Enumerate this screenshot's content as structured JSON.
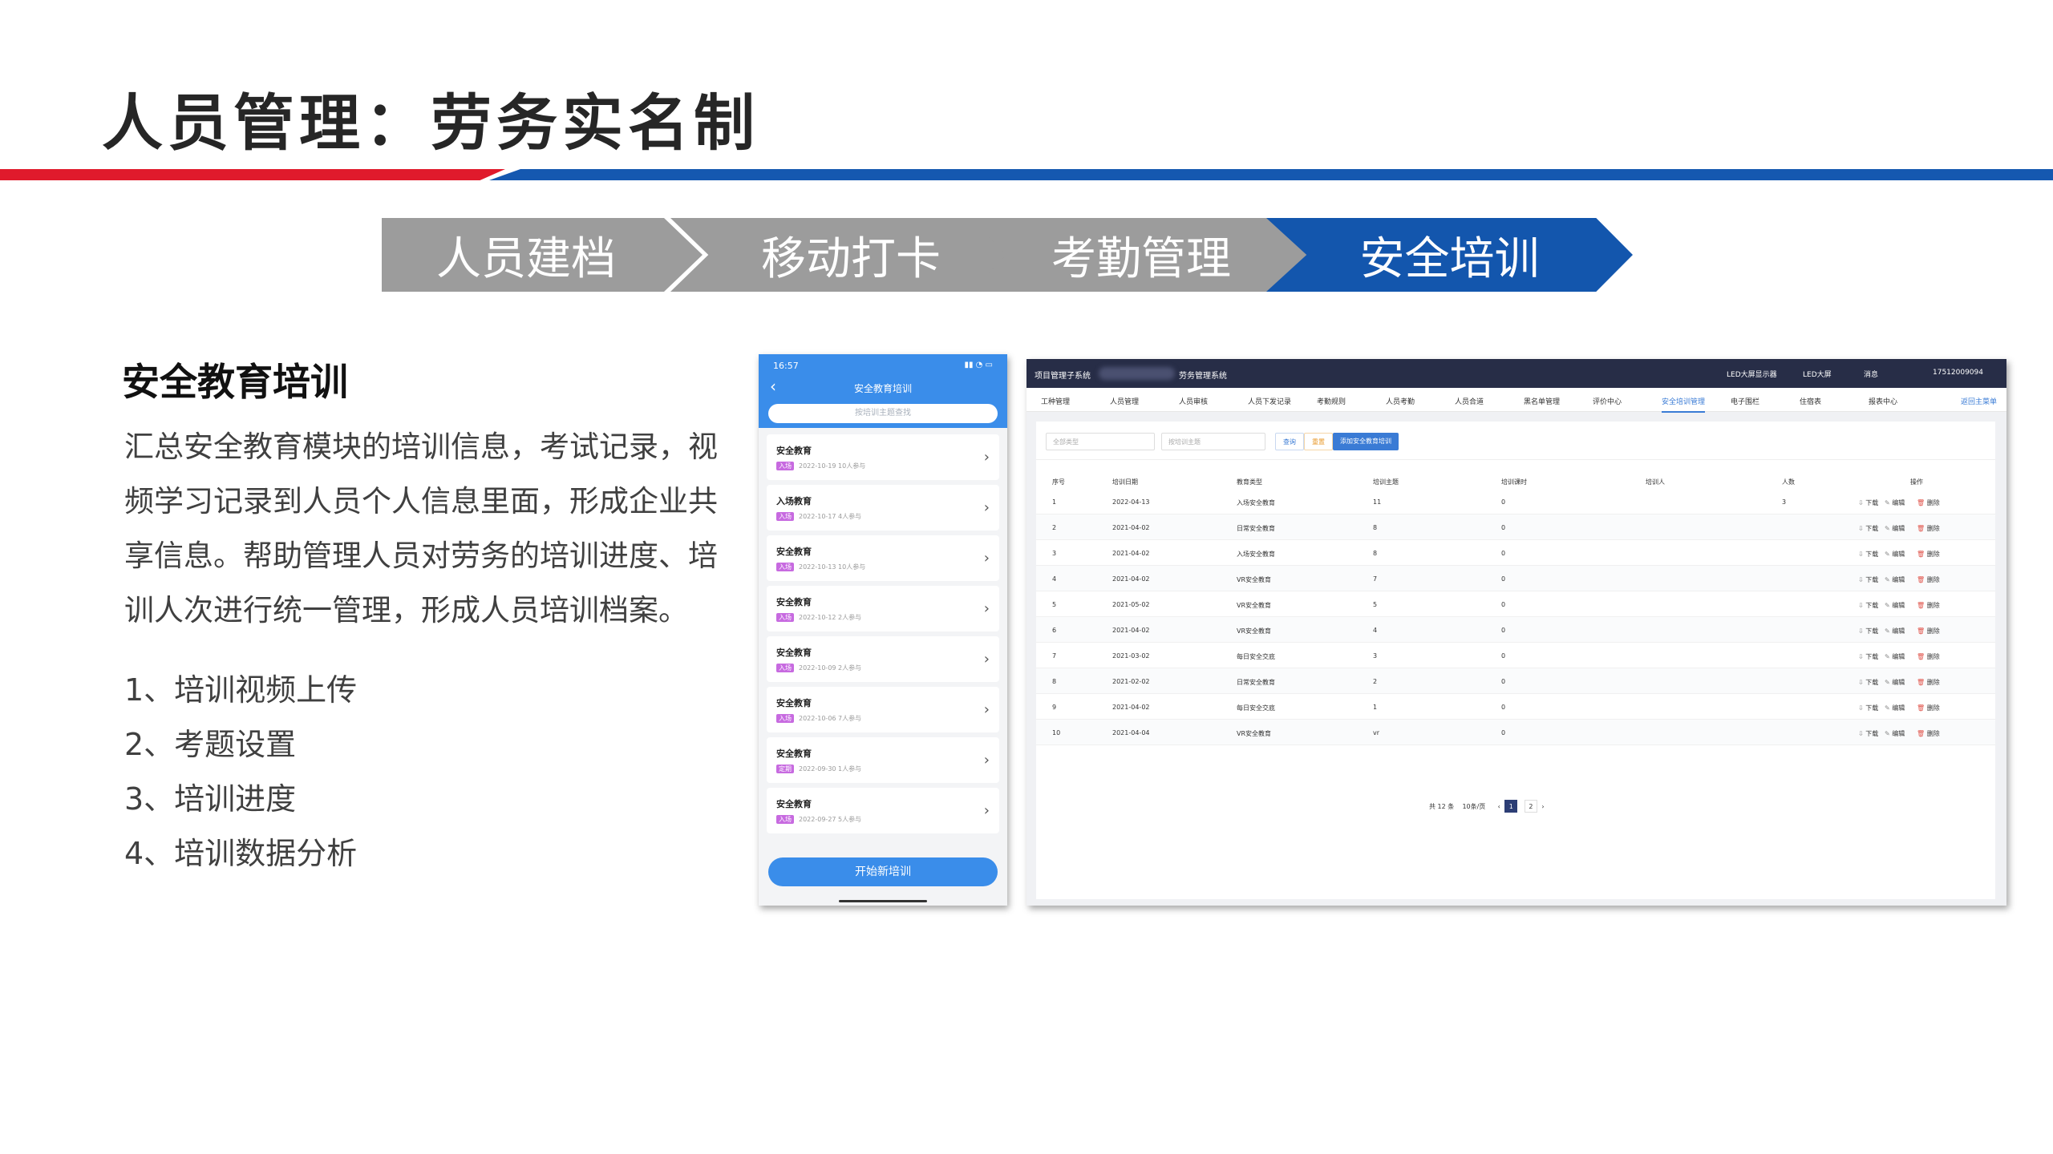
{
  "slide": {
    "title": "人员管理：劳务实名制",
    "steps": [
      "人员建档",
      "移动打卡",
      "考勤管理",
      "安全培训"
    ],
    "section_title": "安全教育培训",
    "description": "汇总安全教育模块的培训信息，考试记录，视频学习记录到人员个人信息里面，形成企业共享信息。帮助管理人员对劳务的培训进度、培训人次进行统一管理，形成人员培训档案。",
    "features": [
      "1、培训视频上传",
      "2、考题设置",
      "3、培训进度",
      "4、培训数据分析"
    ]
  },
  "phone": {
    "status_time": "16:57",
    "back": "‹",
    "title": "安全教育培训",
    "search_placeholder": "按培训主题查找",
    "items": [
      {
        "title": "安全教育",
        "tag": "入场",
        "meta": "2022-10-19  10人参与"
      },
      {
        "title": "入场教育",
        "tag": "入场",
        "meta": "2022-10-17  4人参与"
      },
      {
        "title": "安全教育",
        "tag": "入场",
        "meta": "2022-10-13  10人参与"
      },
      {
        "title": "安全教育",
        "tag": "入场",
        "meta": "2022-10-12  2人参与"
      },
      {
        "title": "安全教育",
        "tag": "入场",
        "meta": "2022-10-09  2人参与"
      },
      {
        "title": "安全教育",
        "tag": "入场",
        "meta": "2022-10-06  7人参与"
      },
      {
        "title": "安全教育",
        "tag": "定期",
        "meta": "2022-09-30  1人参与"
      },
      {
        "title": "安全教育",
        "tag": "入场",
        "meta": "2022-09-27  5人参与"
      }
    ],
    "start_button": "开始新培训"
  },
  "desktop": {
    "system_name": "项目管理子系统",
    "module_name": "劳务管理系统",
    "top_right": [
      "LED大屏显示器",
      "LED大屏",
      "消息",
      "17512009094"
    ],
    "nav": [
      "工种管理",
      "人员管理",
      "人员审核",
      "人员下发记录",
      "考勤规则",
      "人员考勤",
      "人员合道",
      "黑名单管理",
      "评价中心",
      "安全培训管理",
      "电子围栏",
      "住宿表",
      "报表中心",
      "返回主菜单"
    ],
    "filter": {
      "select_placeholder": "全部类型",
      "search_placeholder": "按培训主题",
      "search_btn": "查询",
      "reset_btn": "重置",
      "add_btn": "添加安全教育培训"
    },
    "columns": [
      "序号",
      "培训日期",
      "教育类型",
      "培训主题",
      "培训课时",
      "培训人",
      "人数",
      "操作"
    ],
    "rows": [
      [
        "1",
        "2022-04-13",
        "入场安全教育",
        "11",
        "0",
        "",
        "3"
      ],
      [
        "2",
        "2021-04-02",
        "日常安全教育",
        "8",
        "0",
        "",
        ""
      ],
      [
        "3",
        "2021-04-02",
        "入场安全教育",
        "8",
        "0",
        "",
        ""
      ],
      [
        "4",
        "2021-04-02",
        "VR安全教育",
        "7",
        "0",
        "",
        ""
      ],
      [
        "5",
        "2021-05-02",
        "VR安全教育",
        "5",
        "0",
        "",
        ""
      ],
      [
        "6",
        "2021-04-02",
        "VR安全教育",
        "4",
        "0",
        "",
        ""
      ],
      [
        "7",
        "2021-03-02",
        "每日安全交底",
        "3",
        "0",
        "",
        ""
      ],
      [
        "8",
        "2021-02-02",
        "日常安全教育",
        "2",
        "0",
        "",
        ""
      ],
      [
        "9",
        "2021-04-02",
        "每日安全交底",
        "1",
        "0",
        "",
        ""
      ],
      [
        "10",
        "2021-04-04",
        "VR安全教育",
        "vr",
        "0",
        "",
        ""
      ]
    ],
    "row_actions": [
      "下载",
      "编辑",
      "删除"
    ],
    "pagination": {
      "total": "共 12 条",
      "per_page": "10条/页",
      "pages": [
        "1",
        "2"
      ],
      "current": "1"
    }
  }
}
